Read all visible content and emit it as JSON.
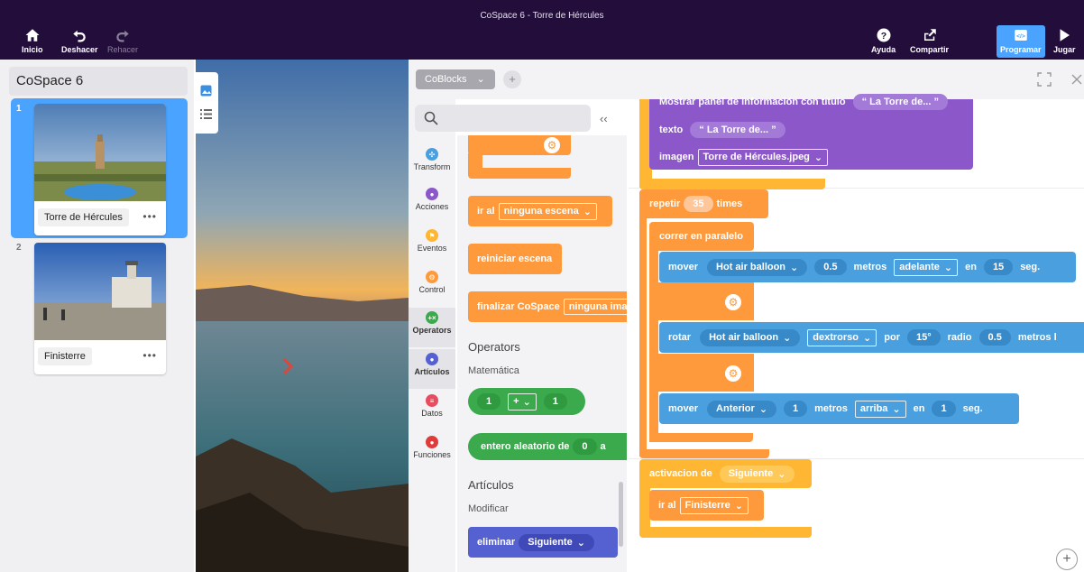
{
  "window": {
    "title": "CoSpace 6 - Torre de Hércules"
  },
  "toolbar": {
    "home_label": "Inicio",
    "undo_label": "Deshacer",
    "redo_label": "Rehacer",
    "help_label": "Ayuda",
    "share_label": "Compartir",
    "code_label": "Programar",
    "play_label": "Jugar"
  },
  "project": {
    "title": "CoSpace 6"
  },
  "scenes": [
    {
      "number": "1",
      "label": "Torre de Hércules",
      "menu": "•••"
    },
    {
      "number": "2",
      "label": "Finisterre",
      "menu": "•••"
    }
  ],
  "code_panel": {
    "tab_label": "CoBlocks",
    "tab_chevron": "⌄",
    "add_tab": "+",
    "collapse": "‹‹"
  },
  "categories": [
    {
      "label": "Transform",
      "color": "#4aa0de",
      "glyph": "✣"
    },
    {
      "label": "Acciones",
      "color": "#8b57c9",
      "glyph": "●"
    },
    {
      "label": "Eventos",
      "color": "#ffb733",
      "glyph": "⚑"
    },
    {
      "label": "Control",
      "color": "#ff9a3c",
      "glyph": "⚙"
    },
    {
      "label": "Operators",
      "color": "#3aaa4c",
      "glyph": "+×"
    },
    {
      "label": "Artículos",
      "color": "#5560d1",
      "glyph": "●"
    },
    {
      "label": "Datos",
      "color": "#e74c5f",
      "glyph": "≡"
    },
    {
      "label": "Funciones",
      "color": "#e03b3b",
      "glyph": "●"
    }
  ],
  "palette": {
    "go_to": "ir al",
    "go_to_value": "ninguna escena",
    "restart": "reiniciar escena",
    "finish": "finalizar CoSpace",
    "finish_value": "ninguna ima",
    "operators_heading": "Operators",
    "math_sub": "Matemática",
    "op_left": "1",
    "op_symbol": "+",
    "op_right": "1",
    "random": "entero aleatorio de",
    "random_from": "0",
    "random_to": "a",
    "items_heading": "Artículos",
    "modify_sub": "Modificar",
    "delete": "eliminar",
    "delete_value": "Siguiente"
  },
  "script": {
    "info_panel": "Mostrar panel de información con título",
    "info_title": "“ La Torre de... ”",
    "text_label": "texto",
    "text_value": "“ La Torre de... ”",
    "image_label": "imagen",
    "image_value": "Torre de Hércules.jpeg",
    "repeat": "repetir",
    "repeat_count": "35",
    "times": "times",
    "parallel": "correr en paralelo",
    "move1": {
      "verb": "mover",
      "target": "Hot air balloon",
      "amount": "0.5",
      "unit": "metros",
      "direction": "adelante",
      "in": "en",
      "seconds": "15",
      "sec_unit": "seg."
    },
    "rotate": {
      "verb": "rotar",
      "target": "Hot air balloon",
      "direction": "dextrorso",
      "by": "por",
      "angle": "15°",
      "radius_label": "radio",
      "radius": "0.5",
      "unit": "metros l"
    },
    "move2": {
      "verb": "mover",
      "target": "Anterior",
      "amount": "1",
      "unit": "metros",
      "direction": "arriba",
      "in": "en",
      "seconds": "1",
      "sec_unit": "seg."
    },
    "activation": "activacion de",
    "activation_value": "Siguiente",
    "go_to": "ir al",
    "go_to_value": "Finisterre"
  },
  "zoom": {
    "label": "+"
  }
}
